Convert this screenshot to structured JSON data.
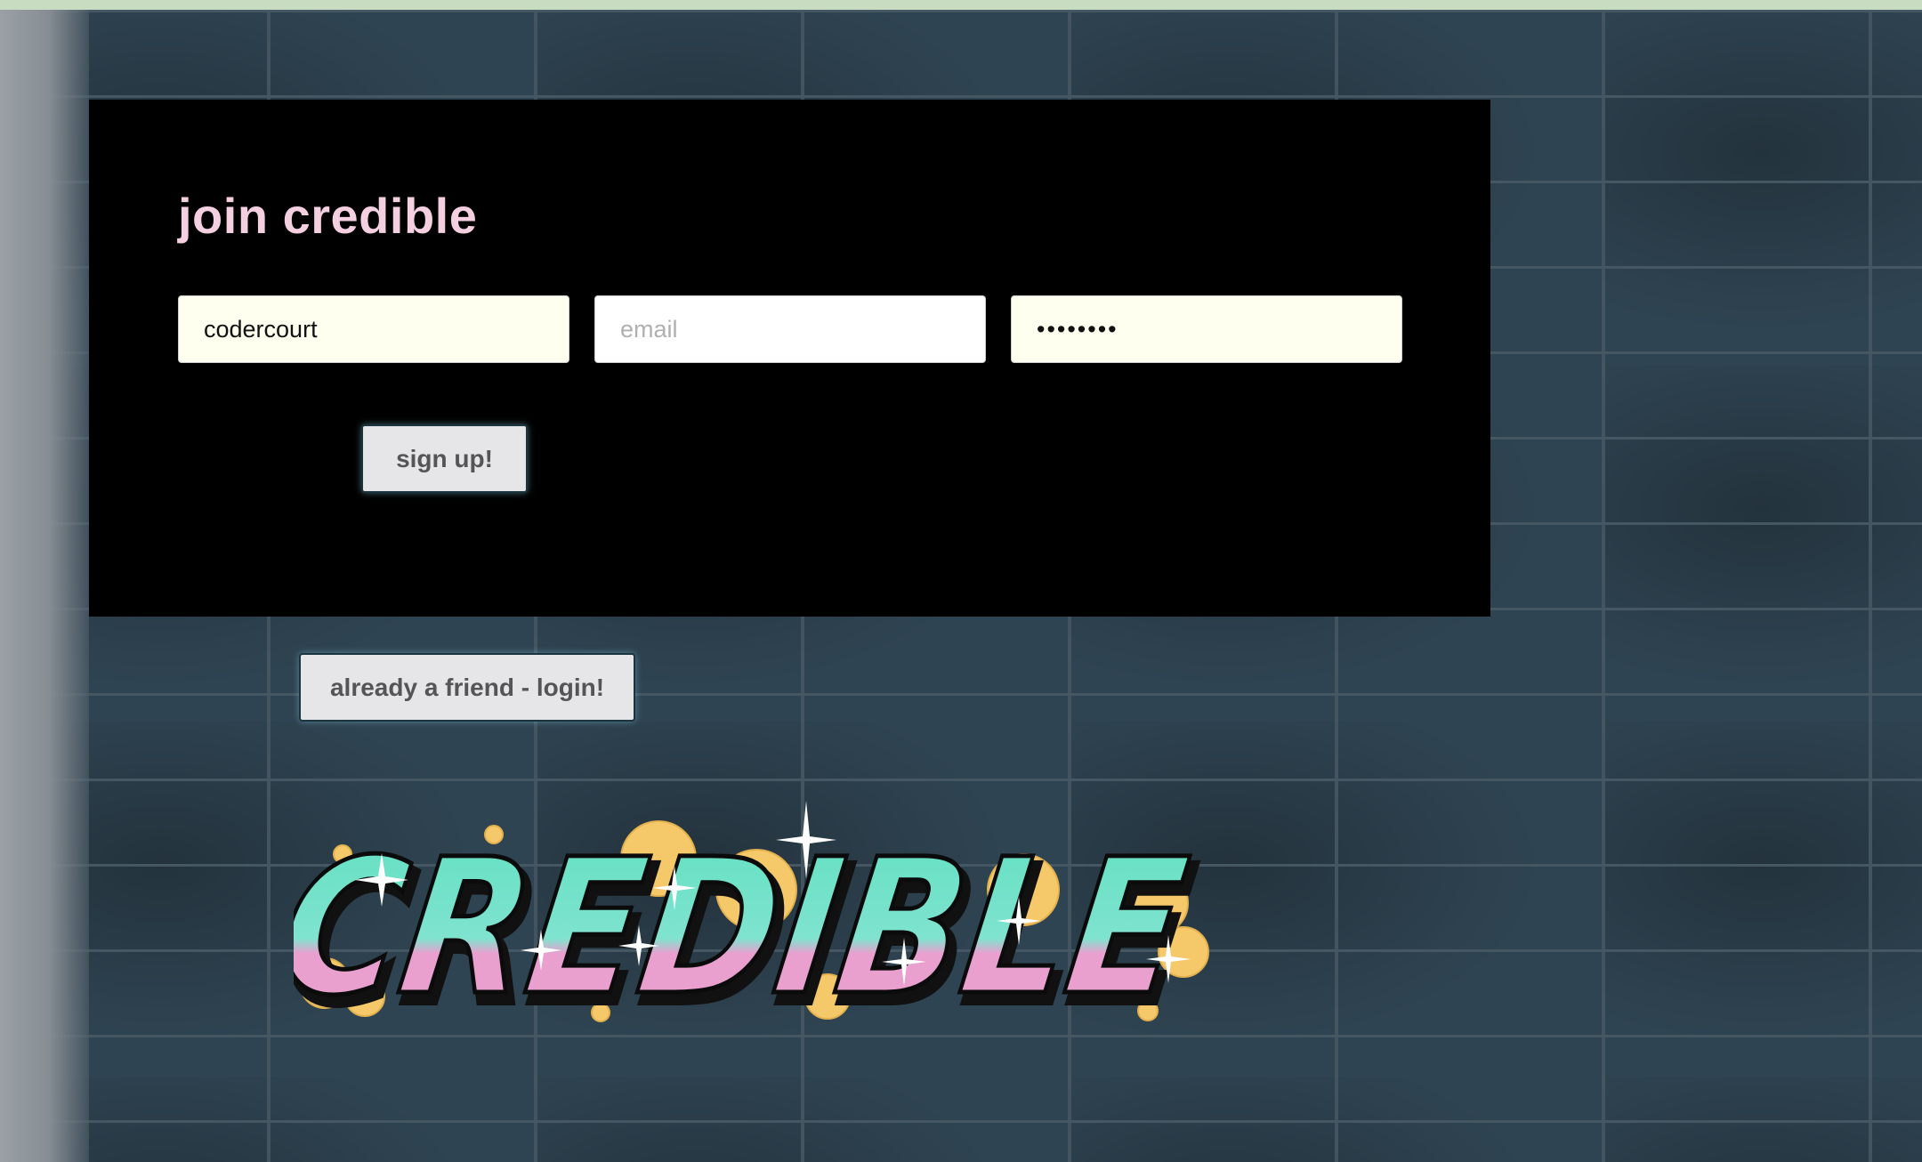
{
  "signup": {
    "heading": "join credible",
    "username_value": "codercourt",
    "email_placeholder": "email",
    "password_value": "••••••••",
    "submit_label": "sign up!"
  },
  "login": {
    "label": "already a friend - login!"
  },
  "logo": {
    "text": "CREDIBLE"
  },
  "colors": {
    "heading": "#f3cfe0",
    "card_bg": "#000000",
    "button_bg": "#e6e6e8",
    "logo_top": "#5fe0c0",
    "logo_bottom": "#e9a0cf",
    "logo_cloud": "#f5c96a"
  }
}
